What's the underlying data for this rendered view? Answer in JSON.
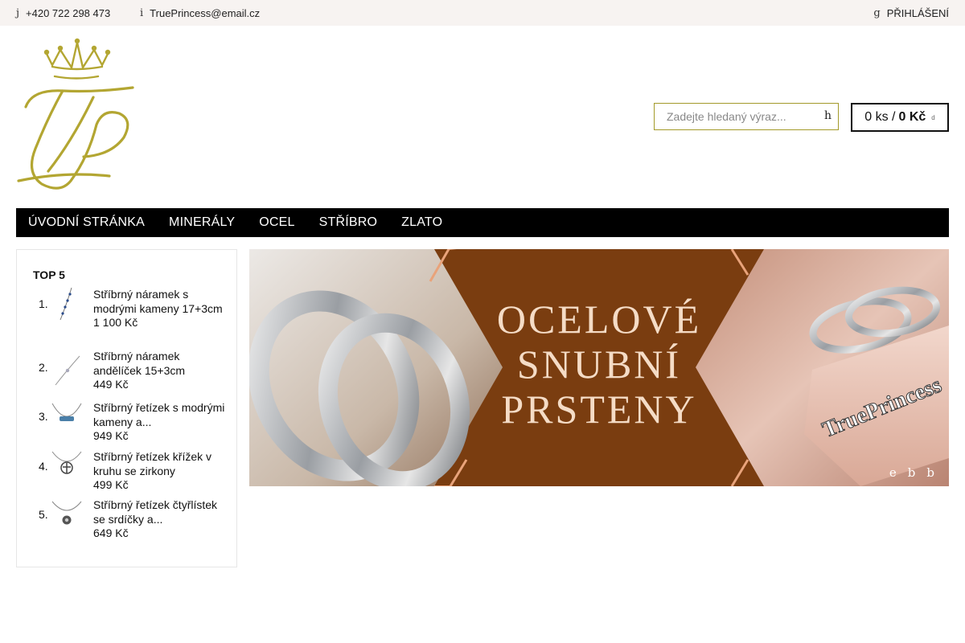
{
  "topbar": {
    "phone_icon": "j",
    "phone": "+420 722 298 473",
    "email_icon": "i",
    "email": "TruePrincess@email.cz",
    "login_icon": "g",
    "login": "PŘIHLÁŠENÍ"
  },
  "search": {
    "placeholder": "Zadejte hledaný výraz...",
    "button_icon": "h"
  },
  "cart": {
    "count": "0 ks /",
    "total": "0 Kč",
    "icon": "d"
  },
  "nav": [
    "ÚVODNÍ STRÁNKA",
    "MINERÁLY",
    "OCEL",
    "STŘÍBRO",
    "ZLATO"
  ],
  "sidebar": {
    "title": "TOP 5",
    "products": [
      {
        "rank": "1.",
        "name": "Stříbrný náramek s modrými kameny 17+3cm",
        "price": "1 100 Kč"
      },
      {
        "rank": "2.",
        "name": "Stříbrný náramek andělíček 15+3cm",
        "price": "449 Kč"
      },
      {
        "rank": "3.",
        "name": "Stříbrný řetízek s modrými kameny a...",
        "price": "949 Kč"
      },
      {
        "rank": "4.",
        "name": "Stříbrný řetízek křížek v kruhu se zirkony",
        "price": "499 Kč"
      },
      {
        "rank": "5.",
        "name": "Stříbrný řetízek čtyřlístek se srdíčky a...",
        "price": "649 Kč"
      }
    ]
  },
  "banner": {
    "lines": [
      "OCELOVÉ",
      "SNUBNÍ",
      "PRSTENY"
    ],
    "brand": "TruePrincess",
    "dots": [
      "e",
      "b",
      "b"
    ]
  },
  "colors": {
    "gold": "#b3a632",
    "nav_bg": "#000000",
    "banner_brown": "#7a3d10"
  }
}
